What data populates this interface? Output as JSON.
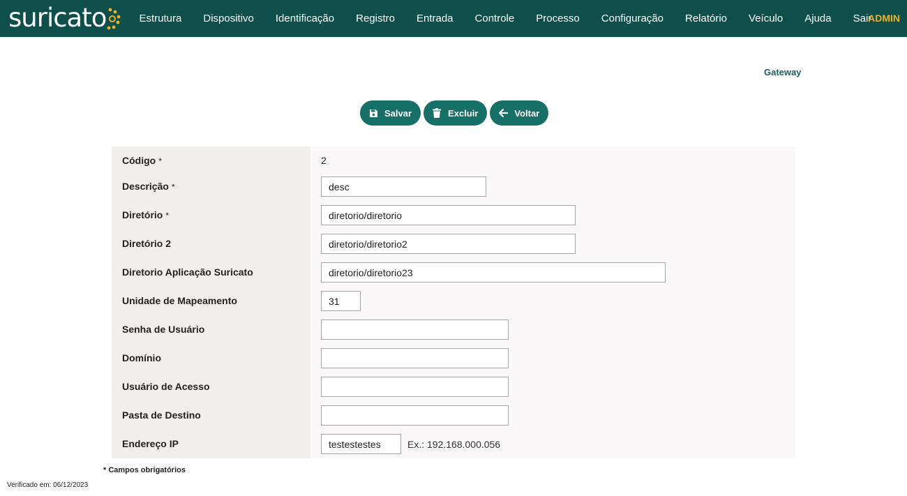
{
  "app": {
    "logo_text": "suricato",
    "menu": [
      "Estrutura",
      "Dispositivo",
      "Identificação",
      "Registro",
      "Entrada",
      "Controle",
      "Processo",
      "Configuração",
      "Relatório",
      "Veículo",
      "Ajuda",
      "Sair"
    ],
    "user": "ADMIN"
  },
  "page": {
    "title": "Gateway"
  },
  "actions": {
    "save": "Salvar",
    "delete": "Excluir",
    "back": "Voltar"
  },
  "form": {
    "codigo": {
      "label": "Código",
      "value": "2"
    },
    "descricao": {
      "label": "Descrição",
      "value": "desc"
    },
    "diretorio": {
      "label": "Diretório",
      "value": "diretorio/diretorio"
    },
    "diretorio2": {
      "label": "Diretório 2",
      "value": "diretorio/diretorio2"
    },
    "diretorio_app": {
      "label": "Diretorio Aplicação Suricato",
      "value": "diretorio/diretorio23"
    },
    "unidade": {
      "label": "Unidade de Mapeamento",
      "value": "31"
    },
    "senha": {
      "label": "Senha de Usuário",
      "value": ""
    },
    "dominio": {
      "label": "Domínio",
      "value": ""
    },
    "usuario": {
      "label": "Usuário de Acesso",
      "value": ""
    },
    "pasta": {
      "label": "Pasta de Destino",
      "value": ""
    },
    "ip": {
      "label": "Endereço IP",
      "value": "testestestes",
      "hint": "Ex.: 192.168.000.056"
    },
    "required_mark": "*"
  },
  "footer": {
    "required_note": "* Campos obrigatórios",
    "verified": "Verificado em: 06/12/2023"
  },
  "colors": {
    "topbar": "#0e4f4c",
    "button": "#177067",
    "admin": "#e9b227",
    "logo_dots": "#e9b227"
  },
  "icons": {
    "save": "floppy-disk-icon",
    "delete": "trash-icon",
    "back": "arrow-left-icon"
  }
}
